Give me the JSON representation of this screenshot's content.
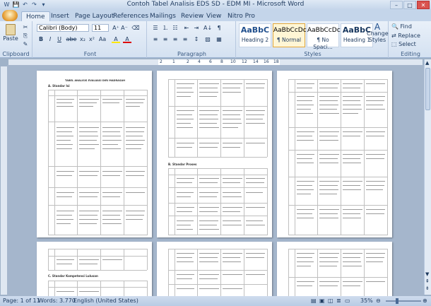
{
  "window": {
    "title": "Contoh Tabel Analisis EDS SD - EDM MI - Microsoft Word",
    "minimize": "–",
    "maximize": "□",
    "close": "✕"
  },
  "quick_access": [
    "W",
    "💾",
    "↶",
    "↷",
    "▾"
  ],
  "tabs": [
    "Home",
    "Insert",
    "Page Layout",
    "References",
    "Mailings",
    "Review",
    "View",
    "Nitro Pro"
  ],
  "ribbon": {
    "clipboard": {
      "label": "Clipboard",
      "paste": "Paste"
    },
    "font": {
      "label": "Font",
      "name": "Calibri (Body)",
      "size": "11",
      "buttons": [
        "B",
        "I",
        "U",
        "abe",
        "x₂",
        "x²",
        "Aa",
        "A",
        "A"
      ]
    },
    "paragraph": {
      "label": "Paragraph",
      "buttons": [
        "≡",
        "≡",
        "≡",
        "≡",
        "↕",
        "¶",
        "⇤",
        "⇥",
        "A↓"
      ]
    },
    "styles": {
      "label": "Styles",
      "items": [
        {
          "preview": "AaBbC",
          "name": "Heading 2"
        },
        {
          "preview": "AaBbCcDc",
          "name": "¶ Normal"
        },
        {
          "preview": "AaBbCcDc",
          "name": "¶ No Spaci..."
        },
        {
          "preview": "AaBbC",
          "name": "Heading 1"
        }
      ],
      "change": "Change Styles"
    },
    "editing": {
      "label": "Editing",
      "find": "Find",
      "replace": "Replace",
      "select": "Select"
    }
  },
  "ruler": {
    "marks": [
      "2",
      "1",
      "2",
      "4",
      "6",
      "8",
      "10",
      "12",
      "14",
      "16",
      "18"
    ]
  },
  "pages": {
    "p1_title": "TABEL ANALISIS EVALUASI DIRI MADRASAH",
    "p1_section": "A. Standar Isi",
    "p2_section": "B. Standar Proses",
    "p4_section": "C. Standar Kompetensi Lulusan"
  },
  "status": {
    "page": "Page: 1 of 11",
    "words": "Words: 3.770",
    "language": "English (United States)",
    "zoom": "35%"
  },
  "colors": {
    "accent": "#e3a83a",
    "ribbon": "#dbe6f4"
  }
}
